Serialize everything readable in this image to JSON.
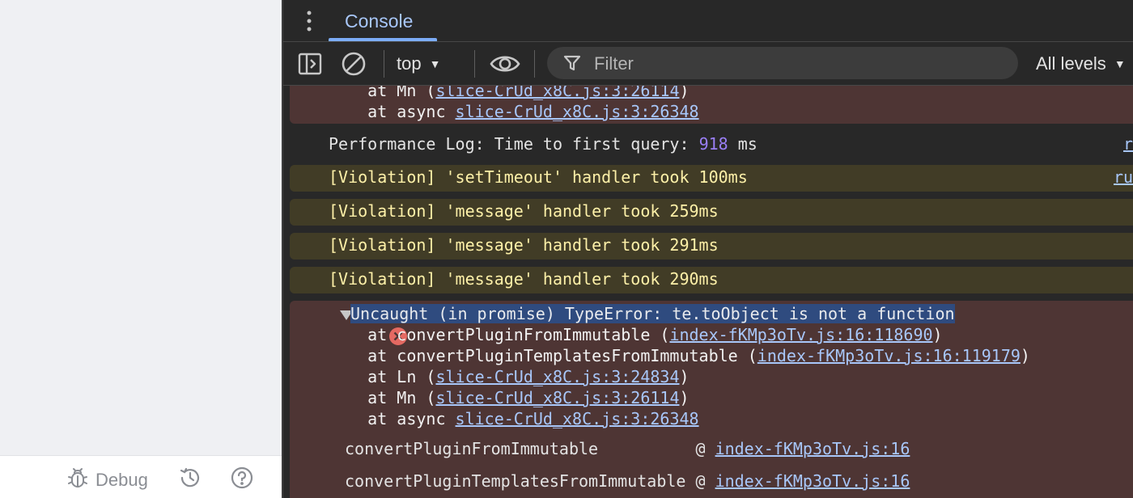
{
  "left_footer": {
    "debug_label": "Debug",
    "icons": [
      "bug-icon",
      "history-icon",
      "help-icon"
    ]
  },
  "devtools": {
    "tabs": [
      {
        "label": "Console",
        "active": true
      }
    ],
    "toolbar": {
      "context": "top",
      "filter_placeholder": "Filter",
      "levels": "All levels"
    }
  },
  "console": {
    "prev_error_tail": [
      {
        "text": "    at Mn (",
        "link": "slice-CrUd_x8C.js:3:26114",
        "suffix": ")"
      },
      {
        "text": "    at async ",
        "link": "slice-CrUd_x8C.js:3:26348",
        "suffix": ""
      }
    ],
    "perf_log": {
      "prefix": "Performance Log: Time to first query: ",
      "value": "918",
      "suffix": " ms",
      "edge_link": "r"
    },
    "violations": [
      {
        "text": "[Violation] 'setTimeout' handler took 100ms",
        "edge_link": "ru"
      },
      {
        "text": "[Violation] 'message' handler took 259ms"
      },
      {
        "text": "[Violation] 'message' handler took 291ms"
      },
      {
        "text": "[Violation] 'message' handler took 290ms"
      }
    ],
    "error": {
      "headline": "Uncaught (in promise) TypeError: te.toObject is not a function",
      "stack": [
        {
          "text": "    at convertPluginFromImmutable (",
          "link": "index-fKMp3oTv.js:16:118690",
          "suffix": ")"
        },
        {
          "text": "    at convertPluginTemplatesFromImmutable (",
          "link": "index-fKMp3oTv.js:16:119179",
          "suffix": ")"
        },
        {
          "text": "    at Ln (",
          "link": "slice-CrUd_x8C.js:3:24834",
          "suffix": ")"
        },
        {
          "text": "    at Mn (",
          "link": "slice-CrUd_x8C.js:3:26114",
          "suffix": ")"
        },
        {
          "text": "    at async ",
          "link": "slice-CrUd_x8C.js:3:26348",
          "suffix": ""
        }
      ],
      "frames": [
        {
          "name": "convertPluginFromImmutable          @ ",
          "link": "index-fKMp3oTv.js:16"
        },
        {
          "name": "convertPluginTemplatesFromImmutable @ ",
          "link": "index-fKMp3oTv.js:16"
        }
      ]
    }
  }
}
